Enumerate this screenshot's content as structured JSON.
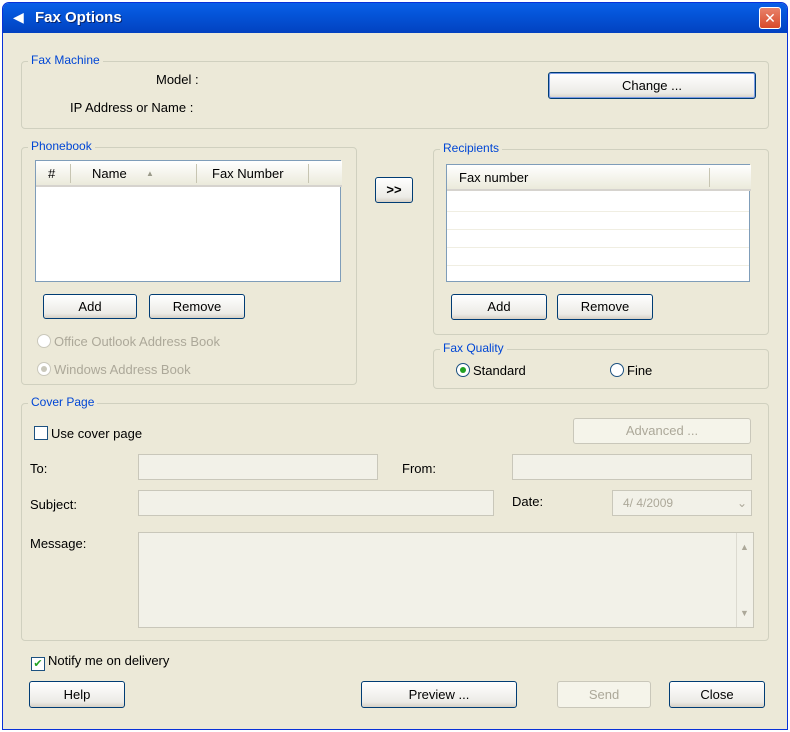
{
  "window": {
    "title": "Fax Options",
    "close_glyph": "✕"
  },
  "fax_machine": {
    "label": "Fax Machine",
    "model_label": "Model :",
    "ip_label": "IP Address or Name :",
    "change_button": "Change ..."
  },
  "phonebook": {
    "label": "Phonebook",
    "columns": [
      "#",
      "Name",
      "Fax Number"
    ],
    "sort_indicator": "▲",
    "add_button": "Add",
    "remove_button": "Remove",
    "source_options": [
      {
        "label": "Office Outlook Address Book",
        "selected": false
      },
      {
        "label": "Windows Address Book",
        "selected": true
      }
    ]
  },
  "transfer_button": ">>",
  "recipients": {
    "label": "Recipients",
    "column": "Fax number",
    "add_button": "Add",
    "remove_button": "Remove"
  },
  "fax_quality": {
    "label": "Fax Quality",
    "options": [
      {
        "label": "Standard",
        "selected": true
      },
      {
        "label": "Fine",
        "selected": false
      }
    ]
  },
  "cover_page": {
    "label": "Cover Page",
    "use_cover_label": "Use cover page",
    "use_cover_checked": false,
    "advanced_button": "Advanced ...",
    "to_label": "To:",
    "from_label": "From:",
    "subject_label": "Subject:",
    "date_label": "Date:",
    "date_value": "4/ 4/2009",
    "message_label": "Message:"
  },
  "notify": {
    "label": "Notify me on delivery",
    "checked": true,
    "check_glyph": "✔"
  },
  "footer": {
    "help_button": "Help",
    "preview_button": "Preview ...",
    "send_button": "Send",
    "close_button": "Close"
  },
  "icons": {
    "title_icon": "fax-icon",
    "scroll_up": "▲",
    "scroll_down": "▼",
    "dropdown": "⌄"
  }
}
